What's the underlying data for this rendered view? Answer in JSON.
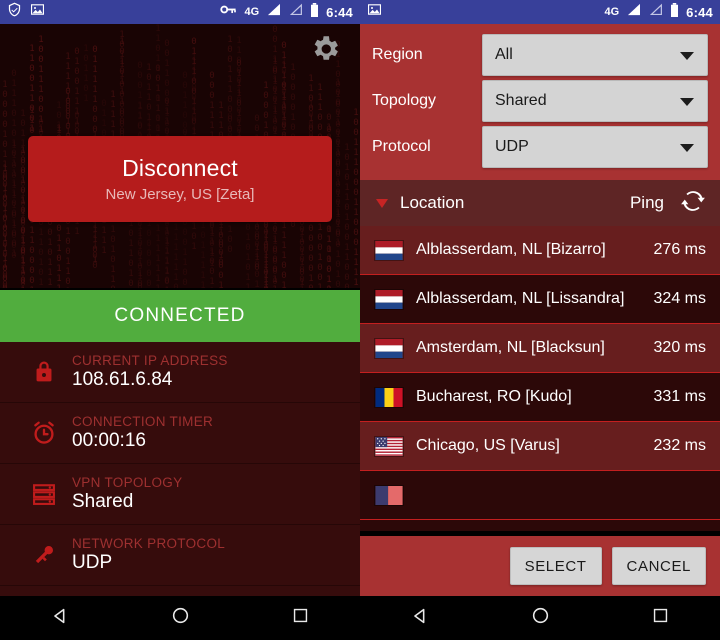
{
  "status_bar": {
    "left_panel_icons": [
      "shield-check-icon",
      "image-icon"
    ],
    "right_panel_icons": [
      "image-icon"
    ],
    "vpn_key_icon": "vpn-key-icon",
    "network_label": "4G",
    "signal_icon": "signal-bars-icon",
    "signal_alt_icon": "signal-bars-empty-icon",
    "battery_icon": "battery-icon",
    "time": "6:44"
  },
  "left": {
    "settings_icon": "gear-icon",
    "matrix_chars": "01001011010010110100101101001011010010110100101101",
    "disconnect": {
      "title": "Disconnect",
      "subtitle": "New Jersey, US [Zeta]"
    },
    "status_banner": "CONNECTED",
    "info_rows": [
      {
        "icon": "lock-icon",
        "label": "CURRENT IP ADDRESS",
        "value": "108.61.6.84"
      },
      {
        "icon": "alarm-clock-icon",
        "label": "CONNECTION TIMER",
        "value": "00:00:16"
      },
      {
        "icon": "server-stack-icon",
        "label": "VPN TOPOLOGY",
        "value": "Shared"
      },
      {
        "icon": "key-icon",
        "label": "NETWORK PROTOCOL",
        "value": "UDP"
      }
    ]
  },
  "right": {
    "filters": [
      {
        "label": "Region",
        "value": "All",
        "caret": "chevron-down-icon"
      },
      {
        "label": "Topology",
        "value": "Shared",
        "caret": "chevron-down-icon"
      },
      {
        "label": "Protocol",
        "value": "UDP",
        "caret": "chevron-down-icon"
      }
    ],
    "list_header": {
      "sort_caret": "sort-descending-icon",
      "location": "Location",
      "ping": "Ping",
      "refresh_icon": "refresh-icon"
    },
    "servers": [
      {
        "flag": "flag-nl",
        "name": "Alblasserdam, NL [Bizarro]",
        "ping": "276 ms"
      },
      {
        "flag": "flag-nl",
        "name": "Alblasserdam, NL [Lissandra]",
        "ping": "324 ms"
      },
      {
        "flag": "flag-nl",
        "name": "Amsterdam, NL [Blacksun]",
        "ping": "320 ms"
      },
      {
        "flag": "flag-ro",
        "name": "Bucharest, RO [Kudo]",
        "ping": "331 ms"
      },
      {
        "flag": "flag-us",
        "name": "Chicago, US [Varus]",
        "ping": "232 ms"
      }
    ],
    "buttons": {
      "select": "SELECT",
      "cancel": "CANCEL"
    }
  },
  "navbar": {
    "back": "back-icon",
    "home": "home-icon",
    "recents": "recents-icon"
  },
  "colors": {
    "status_bar": "#38409a",
    "brand_red": "#a83232",
    "dark_maroon": "#2c0808",
    "row_alt": "#671e1e",
    "connected_green": "#51ad3e",
    "disconnect_red": "#b51c1c",
    "label_red": "#9e3030"
  }
}
